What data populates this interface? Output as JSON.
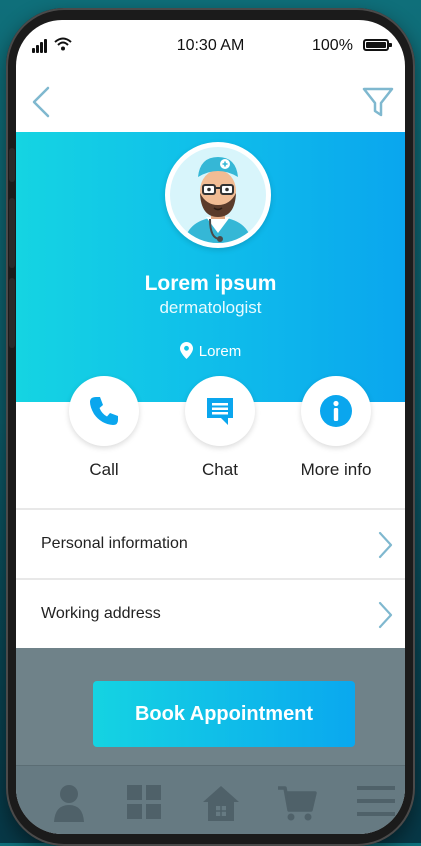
{
  "status_bar": {
    "time": "10:30 AM",
    "battery": "100%"
  },
  "navbar": {
    "back_icon": "chevron-left-icon",
    "filter_icon": "funnel-icon"
  },
  "profile": {
    "name": "Lorem ipsum",
    "specialty": "dermatologist",
    "location": "Lorem",
    "avatar": "doctor-avatar"
  },
  "actions": [
    {
      "label": "Call",
      "icon": "phone-icon"
    },
    {
      "label": "Chat",
      "icon": "chat-icon"
    },
    {
      "label": "More info",
      "icon": "info-icon"
    }
  ],
  "menu": [
    {
      "label": "Personal information"
    },
    {
      "label": "Working address"
    }
  ],
  "cta": {
    "label": "Book Appointment"
  },
  "tabbar": [
    "user-icon",
    "grid-icon",
    "home-icon",
    "cart-icon",
    "menu-icon"
  ],
  "colors": {
    "accent": "#10c0ea",
    "accent_light": "#15d4e2",
    "overlay": "#6f8289"
  }
}
